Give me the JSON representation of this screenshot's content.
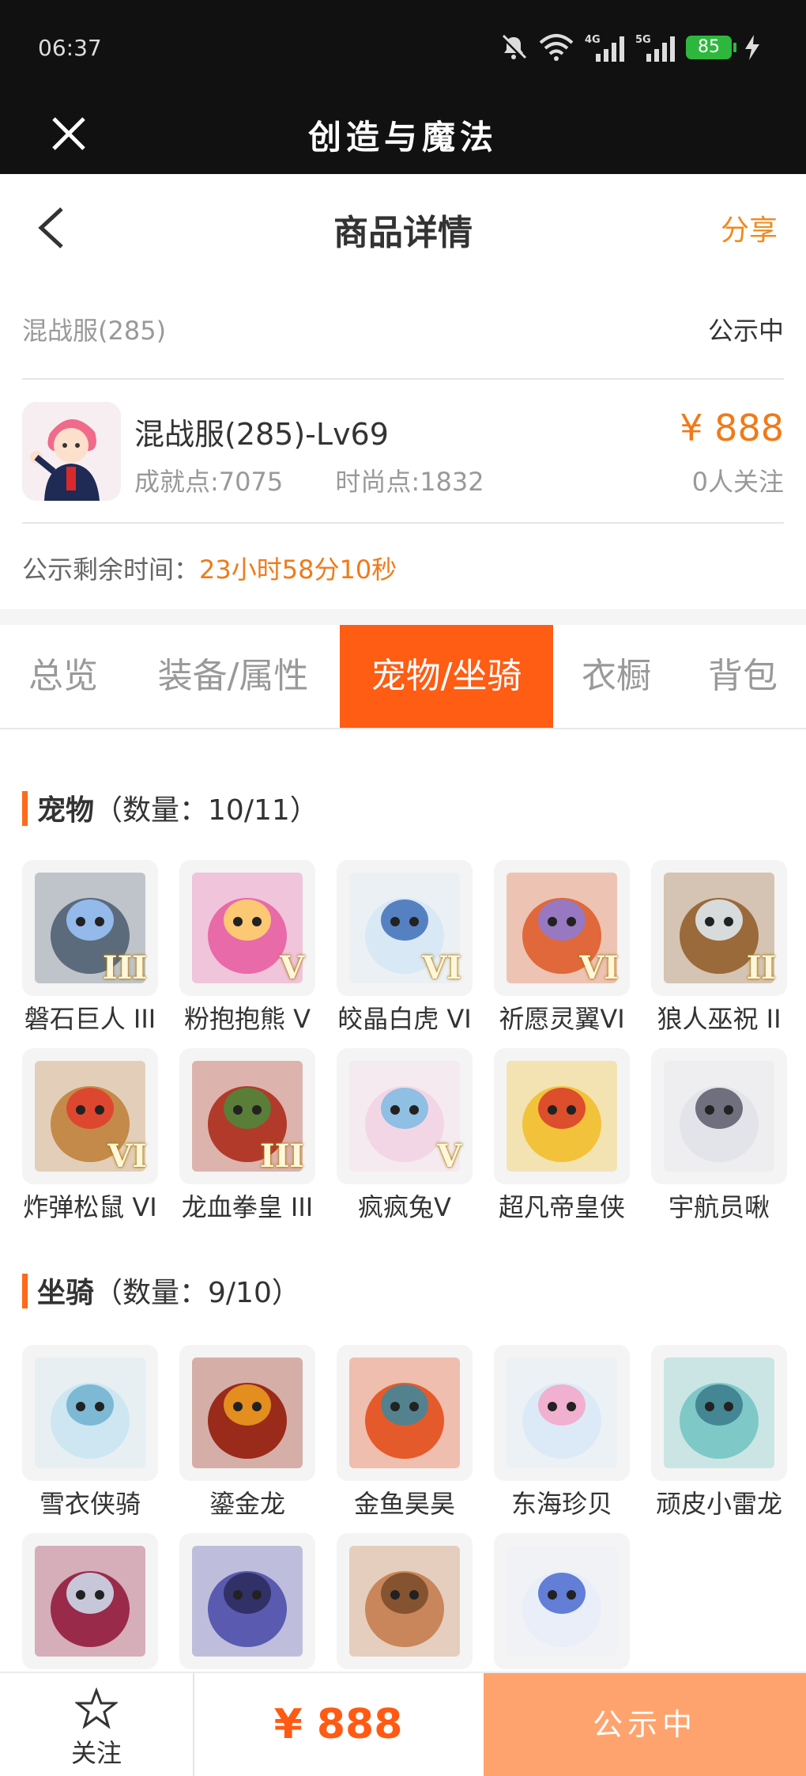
{
  "status_bar": {
    "time": "06:37",
    "battery": "85",
    "net_4g": "4G",
    "net_5g": "5G"
  },
  "app": {
    "title": "创造与魔法"
  },
  "nav": {
    "title": "商品详情",
    "share": "分享"
  },
  "server_row": {
    "server": "混战服(285)",
    "state": "公示中"
  },
  "product": {
    "name": "混战服(285)-Lv69",
    "price": "¥ 888",
    "achievement": "成就点:7075",
    "fashion": "时尚点:1832",
    "followers": "0人关注"
  },
  "countdown": {
    "label": "公示剩余时间：",
    "value": "23小时58分10秒"
  },
  "tabs": [
    "总览",
    "装备/属性",
    "宠物/坐骑",
    "衣橱",
    "背包"
  ],
  "active_tab": 2,
  "pets": {
    "title": "宠物",
    "count": "（数量：10/11）",
    "items": [
      {
        "label": "磐石巨人 III",
        "grade": "III",
        "color": "#5b6b7c",
        "accent": "#9fc7ff"
      },
      {
        "label": "粉抱抱熊 V",
        "grade": "V",
        "color": "#e86aa8",
        "accent": "#ffd86b"
      },
      {
        "label": "皎晶白虎 VI",
        "grade": "VI",
        "color": "#d9e8f5",
        "accent": "#3d6fb8"
      },
      {
        "label": "祈愿灵翼VI",
        "grade": "VI",
        "color": "#e0683a",
        "accent": "#8b7bd8"
      },
      {
        "label": "狼人巫祝 II",
        "grade": "II",
        "color": "#9a6a3a",
        "accent": "#e3eef8"
      },
      {
        "label": "炸弹松鼠 VI",
        "grade": "VI",
        "color": "#c48a4a",
        "accent": "#e23b2b"
      },
      {
        "label": "龙血拳皇 III",
        "grade": "III",
        "color": "#b23a2a",
        "accent": "#4a8a3a"
      },
      {
        "label": "疯疯兔V",
        "grade": "V",
        "color": "#f3d6e6",
        "accent": "#7dbbe0"
      },
      {
        "label": "超凡帝皇侠",
        "grade": "",
        "color": "#f2c23a",
        "accent": "#d83a2a"
      },
      {
        "label": "宇航员啾",
        "grade": "",
        "color": "#e3e3ea",
        "accent": "#5a5a6a"
      }
    ]
  },
  "mounts": {
    "title": "坐骑",
    "count": "（数量：9/10）",
    "items": [
      {
        "label": "雪衣侠骑",
        "color": "#cde6f2",
        "accent": "#6fb0d0"
      },
      {
        "label": "鎏金龙",
        "color": "#9a2a1a",
        "accent": "#f0a020"
      },
      {
        "label": "金鱼昊昊",
        "color": "#e55a2a",
        "accent": "#3a8aa0"
      },
      {
        "label": "东海珍贝",
        "color": "#dceaf7",
        "accent": "#f4a6c8"
      },
      {
        "label": "顽皮小雷龙",
        "color": "#7ec8c8",
        "accent": "#3a7a8a"
      },
      {
        "label": "",
        "color": "#9a2a4a",
        "accent": "#cfe3f2"
      },
      {
        "label": "",
        "color": "#5a5ab0",
        "accent": "#2a2a5a"
      },
      {
        "label": "",
        "color": "#c8865a",
        "accent": "#7a4a2a"
      },
      {
        "label": "",
        "color": "#e9eef8",
        "accent": "#4a6ad0"
      }
    ]
  },
  "bottom": {
    "follow": "关注",
    "total": "¥ 888",
    "action": "公示中"
  }
}
